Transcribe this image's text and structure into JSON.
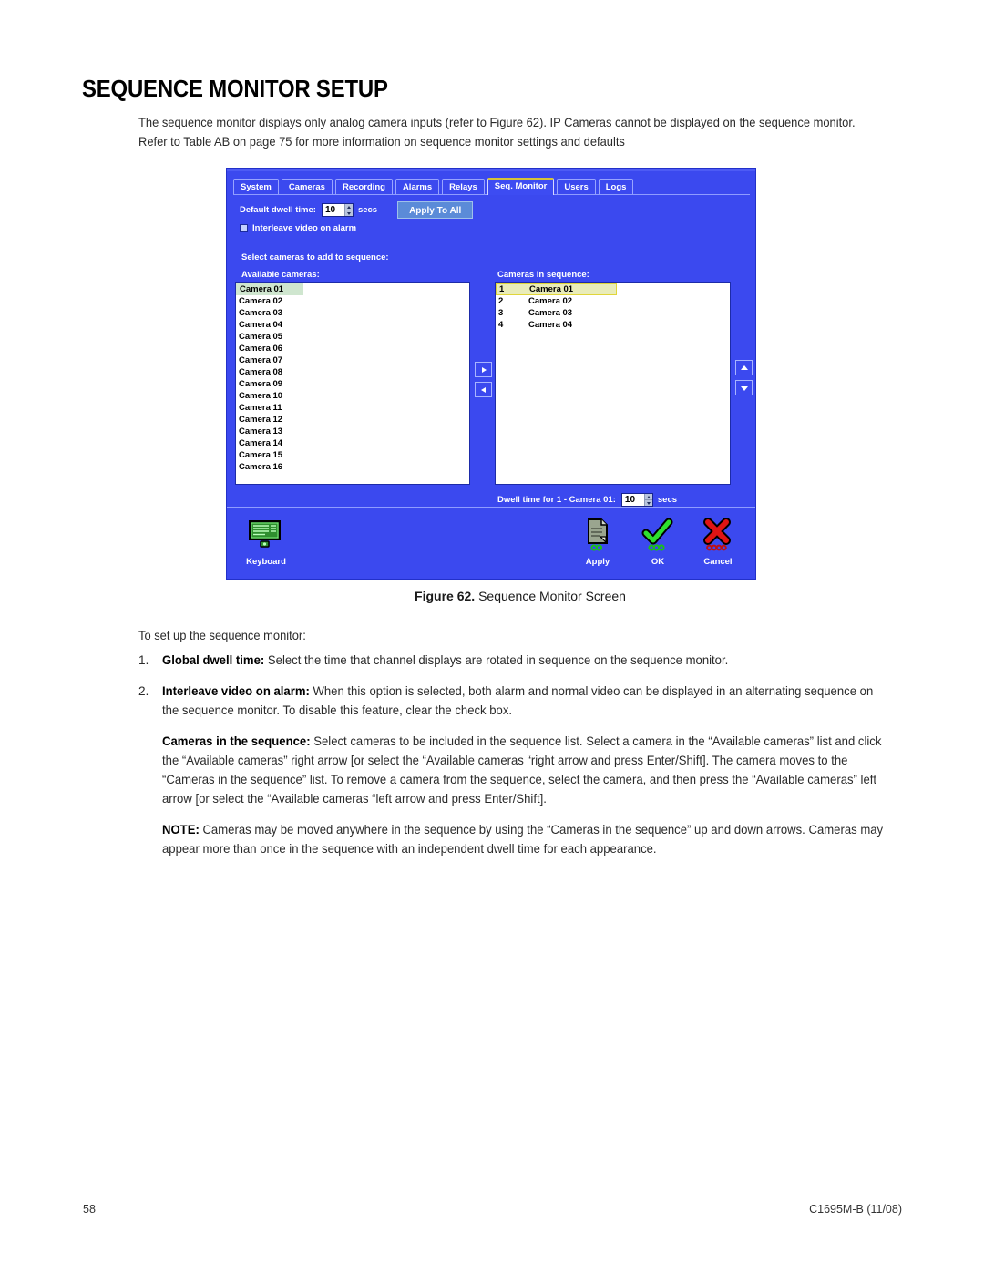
{
  "heading": "SEQUENCE MONITOR SETUP",
  "intro": "The sequence monitor displays only analog camera inputs (refer to Figure 62). IP Cameras cannot be displayed on the sequence monitor. Refer to Table AB on page 75 for more information on sequence monitor settings and defaults",
  "figure": {
    "caption_label": "Figure 62.",
    "caption_text": "Sequence Monitor Screen"
  },
  "lead": "To set up the sequence monitor:",
  "steps": [
    {
      "num": "1.",
      "label": "Global dwell time:",
      "text": " Select the time that channel displays are rotated in sequence on the sequence monitor."
    },
    {
      "num": "2.",
      "label": "Interleave video on alarm:",
      "text": " When this option is selected, both alarm and normal video can be displayed in an alternating sequence on the sequence monitor. To disable this feature, clear the check box."
    }
  ],
  "paragraphs": [
    {
      "label": "Cameras in the sequence:",
      "text": " Select cameras to be included in the sequence list. Select a camera in the “Available cameras” list and click the “Available cameras” right arrow [or select the “Available cameras “right arrow and press Enter/Shift]. The camera moves to the “Cameras in the sequence” list. To remove a camera from the sequence, select the camera, and then press the “Available cameras” left arrow [or select the “Available cameras “left arrow and press Enter/Shift]."
    },
    {
      "label": "NOTE:",
      "text": " Cameras may be moved anywhere in the sequence by using the “Cameras in the sequence” up and down arrows. Cameras may appear more than once in the sequence with an independent dwell time for each appearance."
    }
  ],
  "footer": {
    "page_number": "58",
    "doc_id": "C1695M-B (11/08)"
  },
  "screenshot": {
    "tabs": [
      {
        "label": "System",
        "active": false
      },
      {
        "label": "Cameras",
        "active": false
      },
      {
        "label": "Recording",
        "active": false
      },
      {
        "label": "Alarms",
        "active": false
      },
      {
        "label": "Relays",
        "active": false
      },
      {
        "label": "Seq. Monitor",
        "active": true
      },
      {
        "label": "Users",
        "active": false
      },
      {
        "label": "Logs",
        "active": false
      }
    ],
    "default_dwell": {
      "label": "Default dwell time:",
      "value": "10",
      "units": "secs",
      "apply_all_label": "Apply To All"
    },
    "interleave": {
      "label": "Interleave video on alarm",
      "checked": true
    },
    "select_header": "Select cameras to add to sequence:",
    "available": {
      "header": "Available cameras:",
      "items": [
        "Camera 01",
        "Camera 02",
        "Camera 03",
        "Camera 04",
        "Camera 05",
        "Camera 06",
        "Camera 07",
        "Camera 08",
        "Camera 09",
        "Camera 10",
        "Camera 11",
        "Camera 12",
        "Camera 13",
        "Camera 14",
        "Camera 15",
        "Camera 16"
      ],
      "selected_index": 0
    },
    "sequence": {
      "header": "Cameras in sequence:",
      "items": [
        {
          "index": "1",
          "name": "Camera 01"
        },
        {
          "index": "2",
          "name": "Camera 02"
        },
        {
          "index": "3",
          "name": "Camera 03"
        },
        {
          "index": "4",
          "name": "Camera 04"
        }
      ],
      "selected_index": 0
    },
    "item_dwell": {
      "label": "Dwell time for 1 - Camera 01:",
      "value": "10",
      "units": "secs"
    },
    "transfer_buttons": {
      "add": "move-right",
      "remove": "move-left"
    },
    "reorder_buttons": {
      "up": "move-up",
      "down": "move-down"
    },
    "toolbar": [
      {
        "key": "keyboard",
        "label": "Keyboard"
      },
      {
        "key": "apply",
        "label": "Apply"
      },
      {
        "key": "ok",
        "label": "OK"
      },
      {
        "key": "cancel",
        "label": "Cancel"
      }
    ],
    "colors": {
      "background": "#3b49ef",
      "active_tab_accent": "#d4c33a",
      "list_background": "#ffffff",
      "selection_green": "#cfe6cf",
      "selection_yellow": "#e9ecb9",
      "button_blue": "#5b8bd8",
      "icon_green": "#33cc33",
      "icon_red": "#dd1111"
    }
  }
}
